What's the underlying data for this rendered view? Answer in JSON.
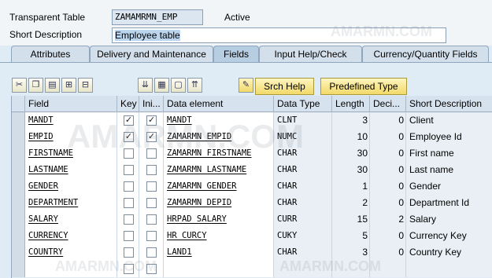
{
  "header": {
    "table_label": "Transparent Table",
    "table_name": "ZAMAMRMN_EMP",
    "status": "Active",
    "desc_label": "Short Description",
    "desc_value": "Employee table"
  },
  "tabs": [
    "Attributes",
    "Delivery and Maintenance",
    "Fields",
    "Input Help/Check",
    "Currency/Quantity Fields"
  ],
  "active_tab": "Fields",
  "toolbar": {
    "srch_help_label": "Srch Help",
    "predefined_type_label": "Predefined Type"
  },
  "columns": [
    "Field",
    "Key",
    "Ini...",
    "Data element",
    "Data Type",
    "Length",
    "Deci...",
    "Short Description"
  ],
  "rows": [
    {
      "field": "MANDT",
      "key": true,
      "init": true,
      "data_element": "MANDT",
      "data_type": "CLNT",
      "length": "3",
      "decimals": "0",
      "description": "Client"
    },
    {
      "field": "EMPID",
      "key": true,
      "init": true,
      "data_element": "ZAMARMN_EMPID",
      "data_type": "NUMC",
      "length": "10",
      "decimals": "0",
      "description": "Employee Id"
    },
    {
      "field": "FIRSTNAME",
      "key": false,
      "init": false,
      "data_element": "ZAMARMN_FIRSTNAME",
      "data_type": "CHAR",
      "length": "30",
      "decimals": "0",
      "description": "First name"
    },
    {
      "field": "LASTNAME",
      "key": false,
      "init": false,
      "data_element": "ZAMARMN_LASTNAME",
      "data_type": "CHAR",
      "length": "30",
      "decimals": "0",
      "description": "Last name"
    },
    {
      "field": "GENDER",
      "key": false,
      "init": false,
      "data_element": "ZAMARMN_GENDER",
      "data_type": "CHAR",
      "length": "1",
      "decimals": "0",
      "description": "Gender"
    },
    {
      "field": "DEPARTMENT",
      "key": false,
      "init": false,
      "data_element": "ZAMARMN_DEPID",
      "data_type": "CHAR",
      "length": "2",
      "decimals": "0",
      "description": "Department Id"
    },
    {
      "field": "SALARY",
      "key": false,
      "init": false,
      "data_element": "HRPAD_SALARY",
      "data_type": "CURR",
      "length": "15",
      "decimals": "2",
      "description": "Salary"
    },
    {
      "field": "CURRENCY",
      "key": false,
      "init": false,
      "data_element": "HR_CURCY",
      "data_type": "CUKY",
      "length": "5",
      "decimals": "0",
      "description": "Currency Key"
    },
    {
      "field": "COUNTRY",
      "key": false,
      "init": false,
      "data_element": "LAND1",
      "data_type": "CHAR",
      "length": "3",
      "decimals": "0",
      "description": "Country Key"
    }
  ],
  "icons": [
    "cut-icon",
    "copy-icon",
    "paste-icon",
    "insert-row-icon",
    "delete-row-icon",
    "sort-icon",
    "select-all-icon",
    "deselect-icon",
    "move-up-icon",
    "data-element-icon"
  ],
  "watermark": "AMARMN.COM"
}
